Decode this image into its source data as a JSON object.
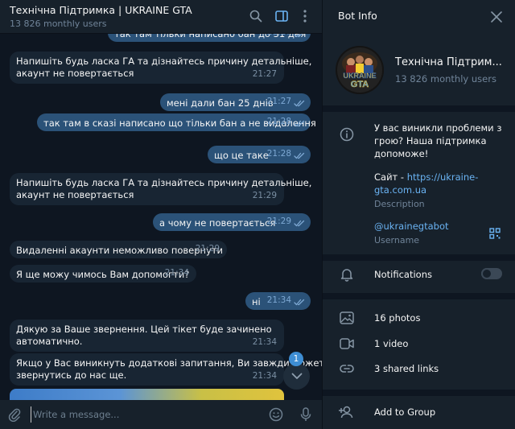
{
  "chat": {
    "title": "Технічна Підтримка | UKRAINE GTA",
    "subtitle": "13 826 monthly users",
    "messages": [
      {
        "dir": "out",
        "text": "так там тільки написано бан до 31 дня",
        "time": "21:27"
      },
      {
        "dir": "in",
        "text": "Напишіть будь ласка ГА та дізнайтесь причину детальніше,\nакаунт не повертається",
        "time": "21:27"
      },
      {
        "dir": "out",
        "text": "мені дали бан 25 днів",
        "time": "21:27"
      },
      {
        "dir": "out",
        "text": "так там в сказі написано що тільки бан а не видалення",
        "time": "21:28"
      },
      {
        "dir": "out",
        "text": "що це таке",
        "time": "21:28"
      },
      {
        "dir": "in",
        "text": "Напишіть будь ласка ГА та дізнайтесь причину детальніше,\nакаунт не повертається",
        "time": "21:29"
      },
      {
        "dir": "out",
        "text": "а чому не повертається",
        "time": "21:29"
      },
      {
        "dir": "in",
        "text": "Видаленні акаунти неможливо повернути",
        "time": "21:29"
      },
      {
        "dir": "in",
        "text": "Я ще можу чимось Вам допомогти?",
        "time": "21:34"
      },
      {
        "dir": "out",
        "text": "ні",
        "time": "21:34"
      },
      {
        "dir": "in",
        "text": "Дякую за Ваше звернення. Цей тікет буде зачинено\nавтоматично.",
        "time": "21:34"
      },
      {
        "dir": "in",
        "text": "Якщо у Вас виникнуть додаткові запитання, Ви завжди можете\nзвернутись до нас ще.",
        "time": "21:34"
      }
    ],
    "unread_badge": "1",
    "composer_placeholder": "Write a message..."
  },
  "info": {
    "title": "Bot Info",
    "bot_name": "Технічна Підтрим...",
    "bot_sub": "13 826 monthly users",
    "avatar_text": "UKRAINE GTA",
    "description": "У вас виникли проблеми з грою? Наша підтримка допоможе!",
    "site_prefix": "Сайт - ",
    "site_link": "https://ukraine-gta.com.ua",
    "description_label": "Description",
    "username": "@ukrainegtabot",
    "username_label": "Username",
    "notifications_label": "Notifications",
    "notifications_on": false,
    "photos": "16 photos",
    "videos": "1 video",
    "links": "3 shared links",
    "add_to_group": "Add to Group"
  },
  "colors": {
    "accent": "#6ab3f3",
    "outgoing_bubble": "#2b5278",
    "incoming_bubble": "#182533"
  }
}
